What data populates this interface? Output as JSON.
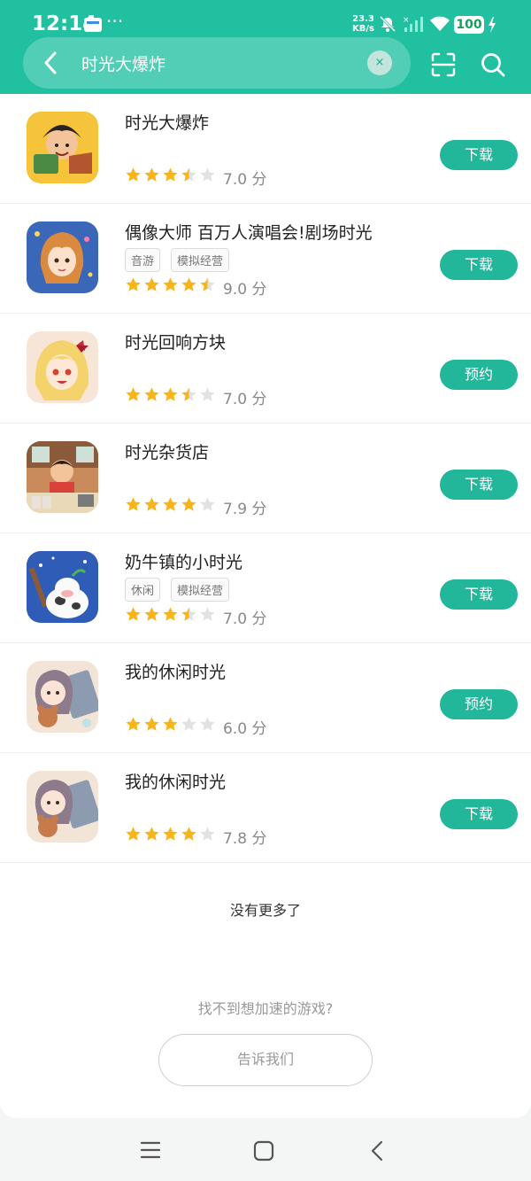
{
  "status": {
    "time": "12:14",
    "dots": "···",
    "speed_value": "23.3",
    "speed_unit": "KB/s",
    "battery": "100"
  },
  "search": {
    "query": "时光大爆炸",
    "clear_label": "×"
  },
  "results": [
    {
      "name": "时光大爆炸",
      "tags": [],
      "stars": 3.5,
      "score": "7.0 分",
      "action": "下载"
    },
    {
      "name": "偶像大师 百万人演唱会!剧场时光",
      "tags": [
        "音游",
        "模拟经营"
      ],
      "stars": 4.5,
      "score": "9.0 分",
      "action": "下载"
    },
    {
      "name": "时光回响方块",
      "tags": [],
      "stars": 3.5,
      "score": "7.0 分",
      "action": "预约"
    },
    {
      "name": "时光杂货店",
      "tags": [],
      "stars": 4,
      "score": "7.9 分",
      "action": "下载"
    },
    {
      "name": "奶牛镇的小时光",
      "tags": [
        "休闲",
        "模拟经营"
      ],
      "stars": 3.5,
      "score": "7.0 分",
      "action": "下载"
    },
    {
      "name": "我的休闲时光",
      "tags": [],
      "stars": 3,
      "score": "6.0 分",
      "action": "预约"
    },
    {
      "name": "我的休闲时光",
      "tags": [],
      "stars": 4,
      "score": "7.8 分",
      "action": "下载"
    }
  ],
  "footer": {
    "no_more": "没有更多了",
    "cant_find": "找不到想加速的游戏?",
    "tell_us": "告诉我们"
  },
  "colors": {
    "accent": "#20c0a0",
    "button": "#22b69a",
    "star": "#f8b51a",
    "star_empty": "#e2e2e2"
  }
}
